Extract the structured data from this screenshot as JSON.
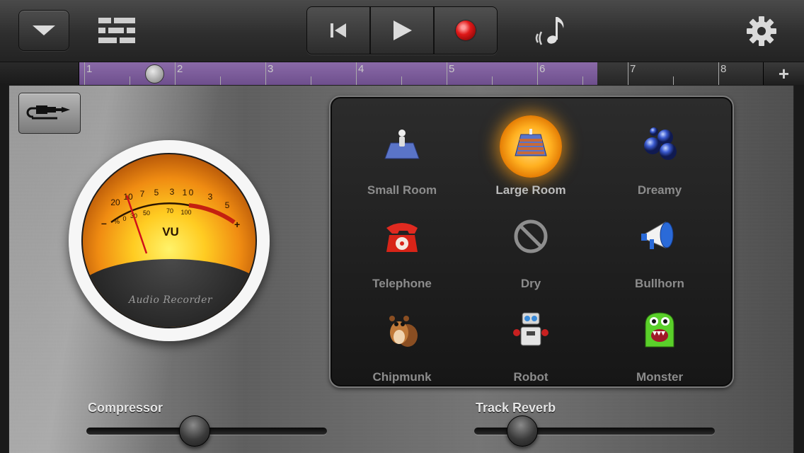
{
  "toolbar": {
    "menu_icon": "chevron-down-icon",
    "tracks_icon": "tracks-view-icon",
    "transport": [
      "rewind-icon",
      "play-icon",
      "record-icon"
    ],
    "instrument_icon": "note-icon",
    "settings_icon": "gear-icon"
  },
  "ruler": {
    "bars": [
      "1",
      "2",
      "3",
      "4",
      "5",
      "6",
      "7",
      "8"
    ],
    "add_label": "+"
  },
  "recorder": {
    "vu_label": "VU",
    "brand": "Audio Recorder",
    "scale_top": [
      "20",
      "10",
      "7",
      "5",
      "3",
      "1",
      "0",
      "3",
      "5"
    ],
    "scale_bottom": [
      "0",
      "30",
      "50",
      "70",
      "100"
    ],
    "minus": "–",
    "plus": "+",
    "percent": "%"
  },
  "effects": [
    {
      "label": "Small Room",
      "icon": "small-room-icon",
      "selected": false
    },
    {
      "label": "Large Room",
      "icon": "large-room-icon",
      "selected": true
    },
    {
      "label": "Dreamy",
      "icon": "bubbles-icon",
      "selected": false
    },
    {
      "label": "Telephone",
      "icon": "telephone-icon",
      "selected": false
    },
    {
      "label": "Dry",
      "icon": "no-effect-icon",
      "selected": false
    },
    {
      "label": "Bullhorn",
      "icon": "megaphone-icon",
      "selected": false
    },
    {
      "label": "Chipmunk",
      "icon": "chipmunk-icon",
      "selected": false
    },
    {
      "label": "Robot",
      "icon": "robot-icon",
      "selected": false
    },
    {
      "label": "Monster",
      "icon": "monster-icon",
      "selected": false
    }
  ],
  "sliders": {
    "compressor": {
      "label": "Compressor",
      "value": 0.45
    },
    "reverb": {
      "label": "Track Reverb",
      "value": 0.2
    }
  },
  "colors": {
    "region": "#7b5c9a",
    "record": "#d81818",
    "selected_glow": "#ffa41c"
  }
}
